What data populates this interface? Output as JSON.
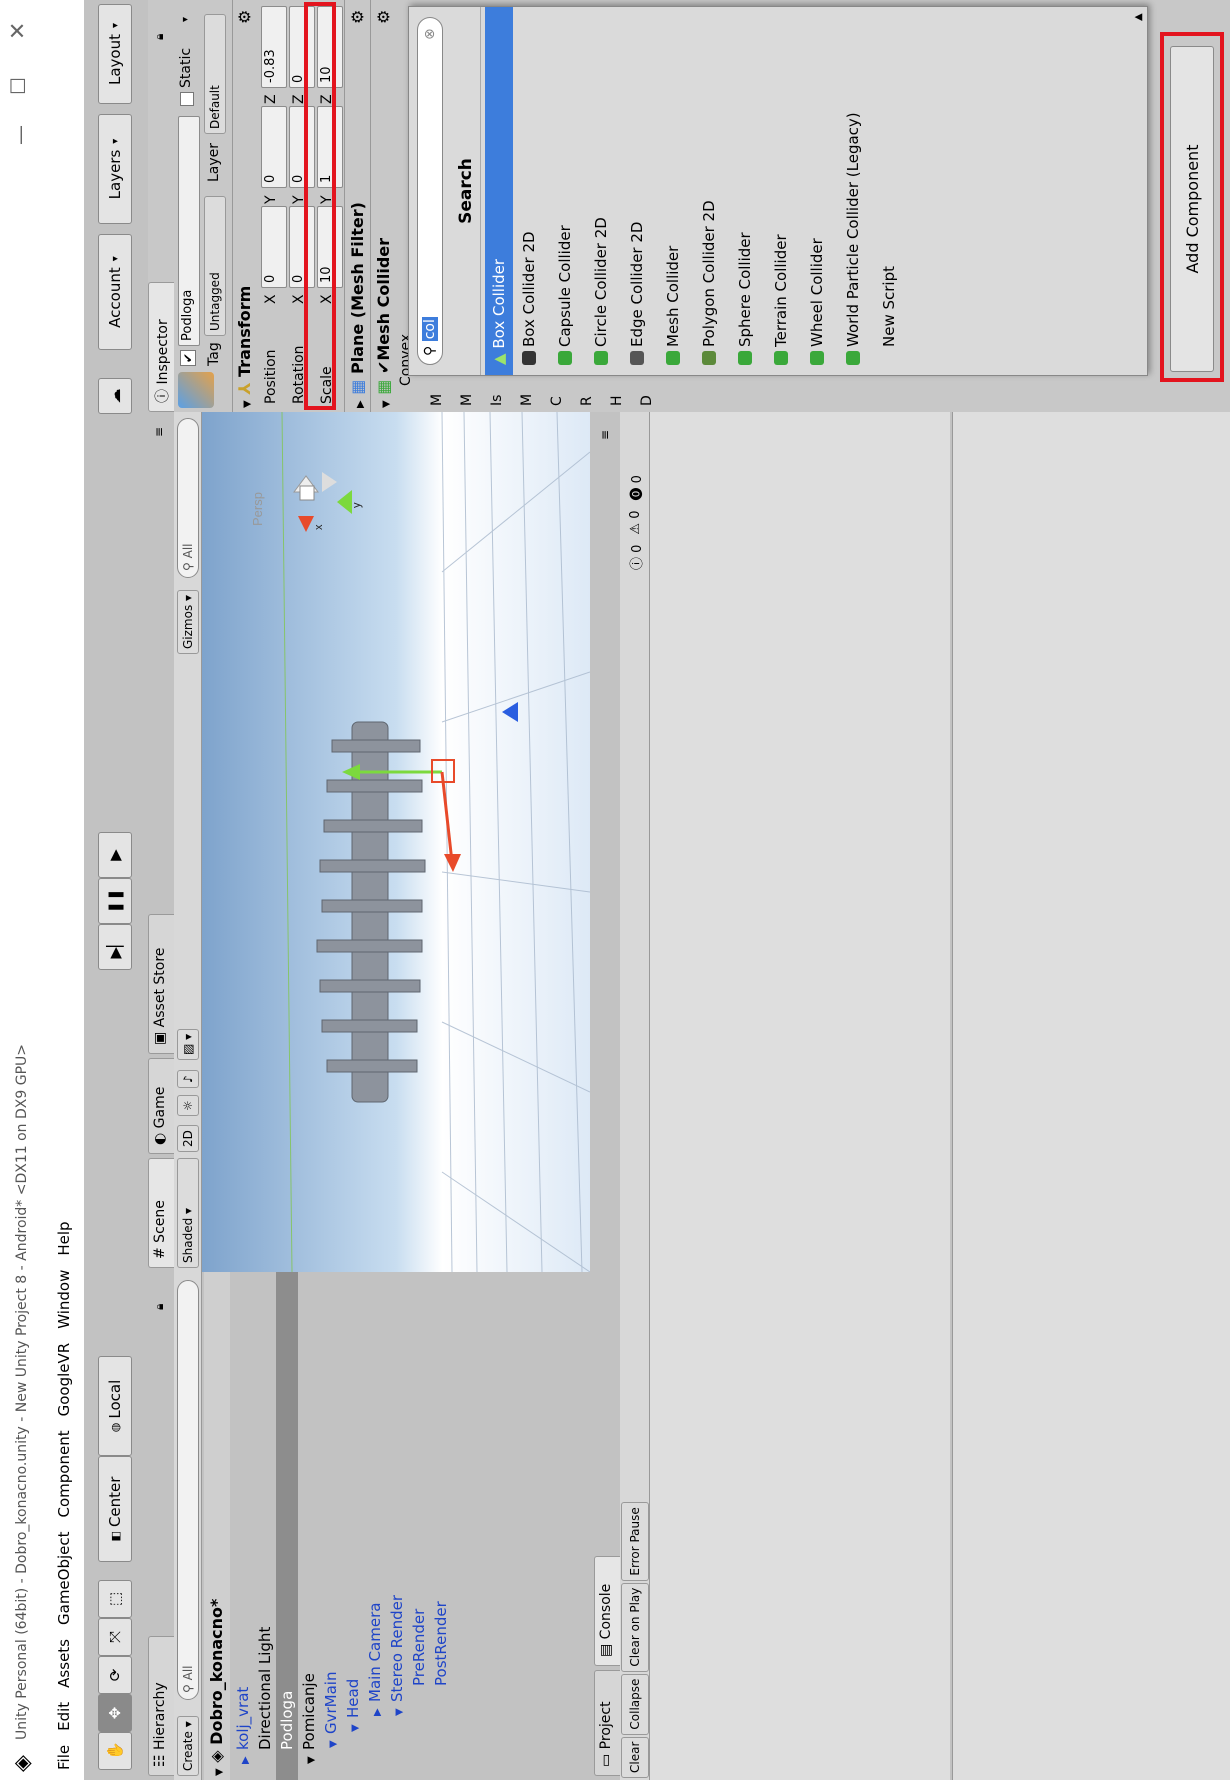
{
  "window": {
    "title": "Unity Personal (64bit) - Dobro_konacno.unity - New Unity Project 8 - Android* <DX11 on DX9 GPU>",
    "minimize_glyph": "—",
    "maximize_glyph": "☐",
    "close_glyph": "✕"
  },
  "menu": [
    "File",
    "Edit",
    "Assets",
    "GameObject",
    "Component",
    "GoogleVR",
    "Window",
    "Help"
  ],
  "toolbar": {
    "center_label": "Center",
    "local_label": "Local",
    "account_label": "Account",
    "layers_label": "Layers",
    "layout_label": "Layout"
  },
  "hierarchy": {
    "tab": "Hierarchy",
    "create_label": "Create",
    "search_placeholder": "All",
    "scene_name": "Dobro_konacno*",
    "items": [
      {
        "label": "kolj_vrat",
        "indent": 1,
        "arrow": true,
        "open": false,
        "blue": true,
        "selected": false
      },
      {
        "label": "Directional Light",
        "indent": 1,
        "arrow": false,
        "open": false,
        "blue": false,
        "selected": false
      },
      {
        "label": "Podloga",
        "indent": 1,
        "arrow": false,
        "open": false,
        "blue": false,
        "selected": true
      },
      {
        "label": "Pomicanje",
        "indent": 1,
        "arrow": true,
        "open": true,
        "blue": false,
        "selected": false
      },
      {
        "label": "GvrMain",
        "indent": 2,
        "arrow": true,
        "open": true,
        "blue": true,
        "selected": false
      },
      {
        "label": "Head",
        "indent": 3,
        "arrow": true,
        "open": true,
        "blue": true,
        "selected": false
      },
      {
        "label": "Main Camera",
        "indent": 4,
        "arrow": true,
        "open": false,
        "blue": true,
        "selected": false
      },
      {
        "label": "Stereo Render",
        "indent": 4,
        "arrow": true,
        "open": true,
        "blue": true,
        "selected": false
      },
      {
        "label": "PreRender",
        "indent": 5,
        "arrow": false,
        "open": false,
        "blue": true,
        "selected": false
      },
      {
        "label": "PostRender",
        "indent": 5,
        "arrow": false,
        "open": false,
        "blue": true,
        "selected": false
      }
    ]
  },
  "scene": {
    "tab_scene": "Scene",
    "tab_game": "Game",
    "tab_store": "Asset Store",
    "shaded": "Shaded",
    "two_d": "2D",
    "gizmos": "Gizmos",
    "search_placeholder": "All",
    "persp": "Persp",
    "axis_x": "x",
    "axis_y": "y"
  },
  "project": {
    "tab_project": "Project",
    "tab_console": "Console",
    "buttons": [
      "Clear",
      "Collapse",
      "Clear on Play",
      "Error Pause"
    ],
    "counts": [
      "0",
      "0",
      "0"
    ]
  },
  "inspector": {
    "tab": "Inspector",
    "object_name": "Podloga",
    "static_label": "Static",
    "tag_label": "Tag",
    "tag_value": "Untagged",
    "layer_label": "Layer",
    "layer_value": "Default",
    "transform_title": "Transform",
    "rows": [
      {
        "label": "Position",
        "x": "0",
        "y": "0",
        "z": "-0.83"
      },
      {
        "label": "Rotation",
        "x": "0",
        "y": "0",
        "z": "0"
      },
      {
        "label": "Scale",
        "x": "10",
        "y": "1",
        "z": "10"
      }
    ],
    "axis": [
      "X",
      "Y",
      "Z"
    ],
    "mesh_filter_title": "Plane (Mesh Filter)",
    "mesh_collider_title": "Mesh Collider",
    "convex_label": "Convex",
    "cut_letters": [
      "M",
      "M",
      "Is",
      "M",
      "C",
      "R",
      "H",
      "D"
    ]
  },
  "component_popup": {
    "search_value": "col",
    "header": "Search",
    "selected": "Box Collider",
    "items": [
      "Box Collider 2D",
      "Capsule Collider",
      "Circle Collider 2D",
      "Edge Collider 2D",
      "Mesh Collider",
      "Polygon Collider 2D",
      "Sphere Collider",
      "Terrain Collider",
      "Wheel Collider",
      "World Particle Collider (Legacy)",
      "New Script"
    ]
  },
  "add_component_label": "Add Component",
  "colors": {
    "accent": "#3d7ddc",
    "highlight": "#e3141e",
    "editor_bg": "#c2c2c2"
  }
}
